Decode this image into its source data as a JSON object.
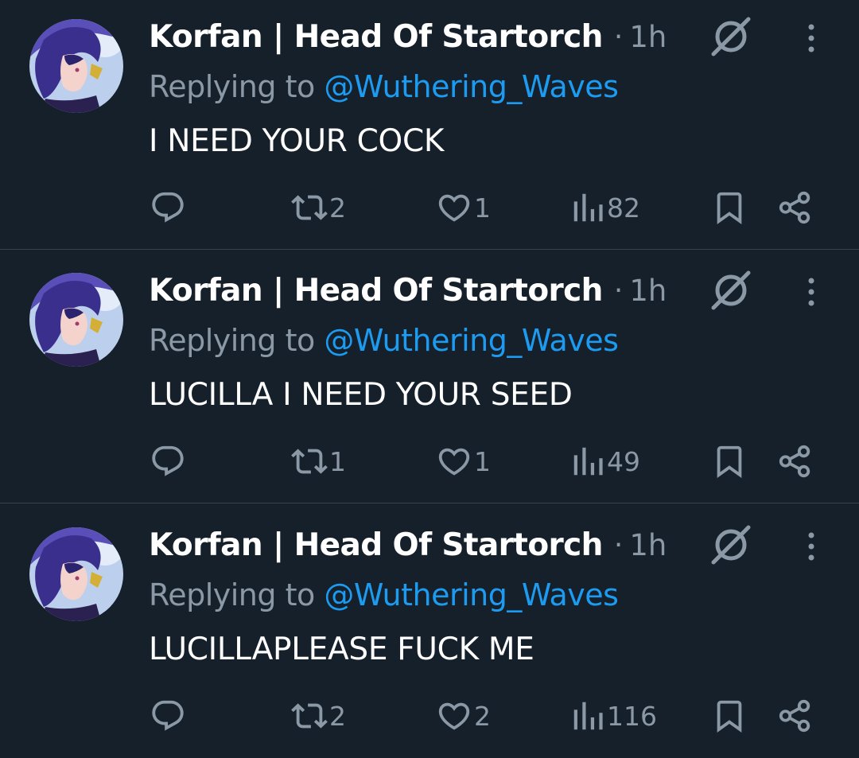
{
  "tweets": [
    {
      "name": "Korfan | Head Of Startorch",
      "separator": "·",
      "time": "1h",
      "replying_prefix": "Replying to",
      "replying_handle": "@Wuthering_Waves",
      "text": "I NEED YOUR COCK",
      "retweets": "2",
      "likes": "1",
      "views": "82"
    },
    {
      "name": "Korfan | Head Of Startorch",
      "separator": "·",
      "time": "1h",
      "replying_prefix": "Replying to",
      "replying_handle": "@Wuthering_Waves",
      "text": "LUCILLA I NEED YOUR SEED",
      "retweets": "1",
      "likes": "1",
      "views": "49"
    },
    {
      "name": "Korfan | Head Of Startorch",
      "separator": "·",
      "time": "1h",
      "replying_prefix": "Replying to",
      "replying_handle": "@Wuthering_Waves",
      "text": "LUCILLAPLEASE FUCK ME",
      "retweets": "2",
      "likes": "2",
      "views": "116"
    }
  ],
  "icons": {
    "grok": "grok-icon",
    "more": "more-vertical-icon",
    "reply": "reply-bubble-icon",
    "retweet": "retweet-icon",
    "like": "heart-icon",
    "views": "bar-chart-icon",
    "bookmark": "bookmark-icon",
    "share": "share-icon"
  },
  "colors": {
    "background": "#15202b",
    "divider": "#38444d",
    "text": "#ffffff",
    "muted": "#8b98a5",
    "link": "#1d9bf0"
  }
}
